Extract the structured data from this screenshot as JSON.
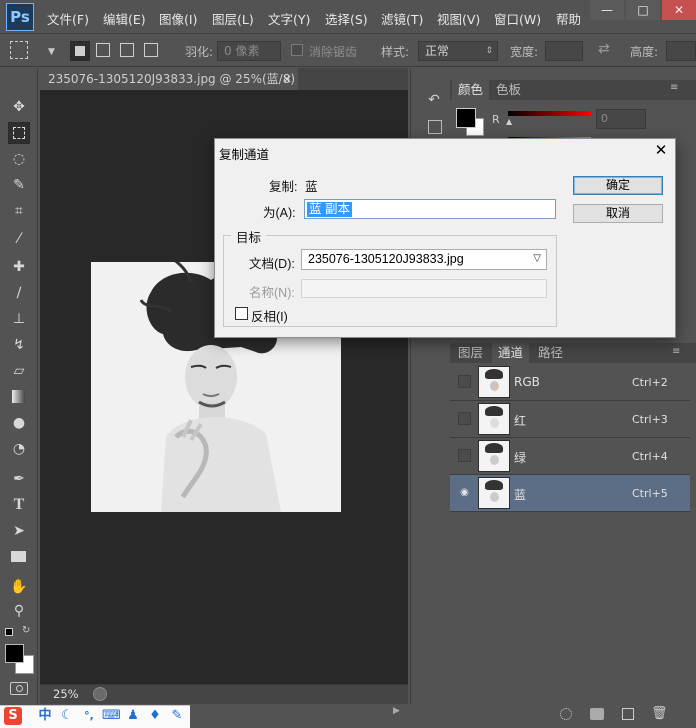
{
  "app": {
    "logo": "Ps",
    "menu": [
      "文件(F)",
      "编辑(E)",
      "图像(I)",
      "图层(L)",
      "文字(Y)",
      "选择(S)",
      "滤镜(T)",
      "视图(V)",
      "窗口(W)",
      "帮助"
    ]
  },
  "window_controls": {
    "minimize": "—",
    "maximize": "□",
    "close": "✕"
  },
  "options_bar": {
    "feather_label": "羽化:",
    "feather_value": "0 像素",
    "antialias_label": "消除锯齿",
    "style_label": "样式:",
    "style_value": "正常",
    "width_label": "宽度:",
    "height_label": "高度:"
  },
  "document": {
    "tab_title": "235076-1305120J93833.jpg @ 25%(蓝/8)",
    "tab_close": "×",
    "zoom": "25%"
  },
  "color_panel": {
    "tabs": [
      "颜色",
      "色板"
    ],
    "r_label": "R",
    "r_value": "0"
  },
  "channels_panel": {
    "tabs": [
      "图层",
      "通道",
      "路径"
    ],
    "rows": [
      {
        "name": "RGB",
        "shortcut": "Ctrl+2",
        "visible": false
      },
      {
        "name": "红",
        "shortcut": "Ctrl+3",
        "visible": false
      },
      {
        "name": "绿",
        "shortcut": "Ctrl+4",
        "visible": false
      },
      {
        "name": "蓝",
        "shortcut": "Ctrl+5",
        "visible": true
      }
    ]
  },
  "dialog": {
    "title": "复制通道",
    "close": "✕",
    "copy_label": "复制:",
    "copy_value": "蓝",
    "as_label": "为(A):",
    "as_value": "蓝 副本",
    "ok_label": "确定",
    "cancel_label": "取消",
    "target_legend": "目标",
    "doc_label": "文档(D):",
    "doc_value": "235076-1305120J93833.jpg",
    "name_label": "名称(N):",
    "invert_label": "反相(I)"
  },
  "ime": {
    "logo": "S",
    "lang": "中"
  },
  "colors": {
    "ui_gray": "#535353",
    "canvas_dark": "#282828",
    "selection_blue": "#5b6e86",
    "dialog_bg": "#f0f0f0",
    "text_highlight": "#3399ff"
  }
}
